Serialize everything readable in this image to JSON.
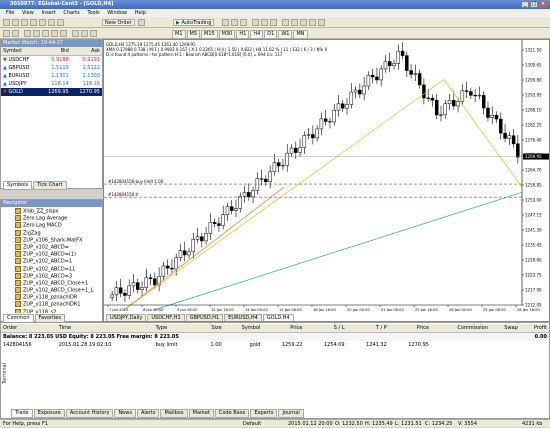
{
  "window": {
    "title": "3010977: EGlobal-Cent3 - [GOLD,H4]"
  },
  "menu": [
    "File",
    "View",
    "Insert",
    "Charts",
    "Tools",
    "Window",
    "Help"
  ],
  "toolbar": {
    "new_order": "New Order",
    "autotrading": "AutoTrading",
    "timeframes": [
      "M1",
      "M5",
      "M15",
      "M30",
      "H1",
      "H4",
      "D1",
      "W1",
      "MN"
    ]
  },
  "market_watch": {
    "title": "Market Watch: 19:44:27",
    "columns": [
      "Symbol",
      "Bid",
      "Ask"
    ],
    "rows": [
      {
        "symbol": "USDCHF",
        "bid": "0.9188",
        "ask": "0.9191",
        "dir": "down"
      },
      {
        "symbol": "GBPUSD",
        "bid": "1.5119",
        "ask": "1.5122",
        "dir": "up"
      },
      {
        "symbol": "EURUSD",
        "bid": "1.1301",
        "ask": "1.1303",
        "dir": "up"
      },
      {
        "symbol": "USDJPY",
        "bid": "118.14",
        "ask": "118.16",
        "dir": "up"
      },
      {
        "symbol": "GOLD",
        "bid": "1269.95",
        "ask": "1270.95",
        "dir": "down",
        "selected": true
      }
    ],
    "tabs": [
      "Symbols",
      "Tick Chart"
    ]
  },
  "navigator": {
    "title": "Navigator",
    "items": [
      "Xlab_ZZ_slspx",
      "Zero Lag Average",
      "Zero Lag MACD",
      "ZigZag",
      "ZUP_v106_Shark-MatFX",
      "ZUP_v102_ABCD=",
      "ZUP_v102_ABCD=(1)",
      "ZUP_v102_ABCD=1",
      "ZUP_v102_ABCD=11",
      "ZUP_v102_ABCD=3",
      "ZUP_v102_ABCD_Close+1",
      "ZUP_v102_ABCD_Close+1_L",
      "ZUP_v118_pznachiDR",
      "ZUP_v118_pznachiDR1",
      "ZUP_v118_s2",
      "ZUP_v111_1MH_LBW1",
      "ZUP_v61_WW_WW",
      "ZUP_v90m"
    ],
    "tabs": [
      "Common",
      "Favorites"
    ]
  },
  "chart": {
    "info1": "GOLD,H4 1275.19 1275.45 1261.40 1269.95",
    "info2": "XMA 0.17988  0.738  | M:1 | 0.9903 0.167 | X:1 0.2265 | H:4 | 1.50 | 0.822 | H4 11.62 % | 11 | 132 / 6 / 3 / N% 0",
    "info3": "D is found 4 patterns  -  for pattern H 1 : Bearish ABCD[0.618*1.618]   [0.0] = 694   Cn: 117",
    "ticket1_label": "#142804156 buy limit 1.00",
    "ticket2_label": "#142804156 tl",
    "price_axis": [
      "1311.50",
      "1305.65",
      "1299.80",
      "1293.95",
      "1288.10",
      "1282.25",
      "1276.40",
      "1270.55",
      "1264.70",
      "1258.85",
      "1253.00",
      "1247.15",
      "1241.30",
      "1235.45",
      "1229.60",
      "1223.75",
      "1217.90",
      "1212.05"
    ],
    "current_price": "1269.95",
    "time_axis": [
      "7 Jan 2015",
      "8 Jan 00:00",
      "9 Jan 08:00",
      "12 Jan 16:00",
      "14 Jan 00:00",
      "15 Jan 08:00",
      "16 Jan 16:00",
      "20 Jan 00:00",
      "21 Jan 08:00",
      "22 Jan 16:00",
      "26 Jan 00:00",
      "27 Jan 08:00",
      "28 Jan 16:00"
    ],
    "tabs": [
      "USDJPY,Daily",
      "USDCHF,H1",
      "GBPUSD,H1",
      "EURUSD,H4",
      "GOLD,H4"
    ],
    "up_color": "#000000",
    "down_color": "#000000"
  },
  "terminal": {
    "columns": [
      "Order",
      "Time",
      "Type",
      "Size",
      "Symbol",
      "Price",
      "S / L",
      "T / P",
      "Price",
      "Commission",
      "Swap",
      "Profit"
    ],
    "balance_line": "Balance: 8 223.05 USD  Equity: 8 223.05  Free margin: 8 223.05",
    "balance_profit": "0.00",
    "orders": [
      {
        "order": "142804156",
        "time": "2015.01.28 19:02:10",
        "type": "buy limit",
        "size": "1.00",
        "symbol": "gold",
        "price": "1259.22",
        "sl": "1254.09",
        "tp": "1241.32",
        "cur": "1270.95",
        "commission": "",
        "swap": "",
        "profit": ""
      }
    ],
    "tabs": [
      "Trade",
      "Exposure",
      "Account History",
      "News",
      "Alerts",
      "Mailbox",
      "Market",
      "Code Base",
      "Experts",
      "Journal"
    ]
  },
  "status": {
    "help": "For Help, press F1",
    "profile": "Default",
    "datetime": "2015.01.12 20:00",
    "open": "O: 1232.50",
    "high": "H: 1235.49",
    "low": "L: 1231.51",
    "close": "C: 1234.25",
    "volume": "V: 3554",
    "traffic": "4231 kb"
  }
}
